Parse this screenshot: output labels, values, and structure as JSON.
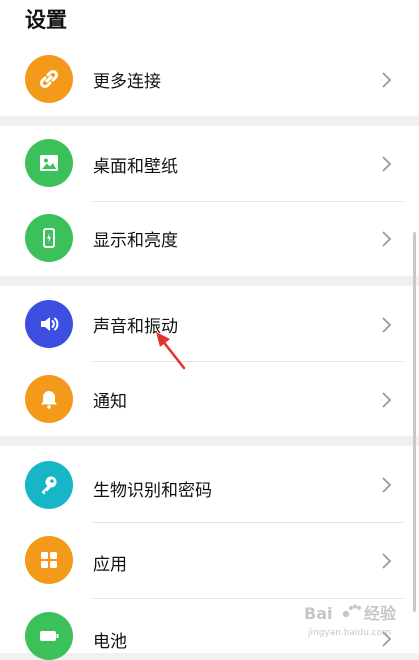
{
  "page": {
    "title": "设置"
  },
  "colors": {
    "more_connections": "#f39a1b",
    "wallpaper": "#3cc05a",
    "display": "#3cc05a",
    "sound": "#3d4fe0",
    "notification": "#f39a1b",
    "biometrics": "#16b6c6",
    "apps": "#f39a1b",
    "battery": "#3cc05a",
    "annotation_arrow": "#e53030"
  },
  "settings": {
    "more_connections": {
      "label": "更多连接",
      "icon": "link-icon"
    },
    "wallpaper": {
      "label": "桌面和壁纸",
      "icon": "image-icon"
    },
    "display": {
      "label": "显示和亮度",
      "icon": "phone-brightness-icon"
    },
    "sound": {
      "label": "声音和振动",
      "icon": "speaker-icon"
    },
    "notification": {
      "label": "通知",
      "icon": "bell-icon"
    },
    "biometrics": {
      "label": "生物识别和密码",
      "icon": "key-icon"
    },
    "apps": {
      "label": "应用",
      "icon": "apps-grid-icon"
    },
    "battery": {
      "label": "电池",
      "icon": "battery-icon"
    }
  },
  "watermark": {
    "brand": "Bai",
    "brand2": "经验",
    "url": "jingyan.baidu.com"
  }
}
